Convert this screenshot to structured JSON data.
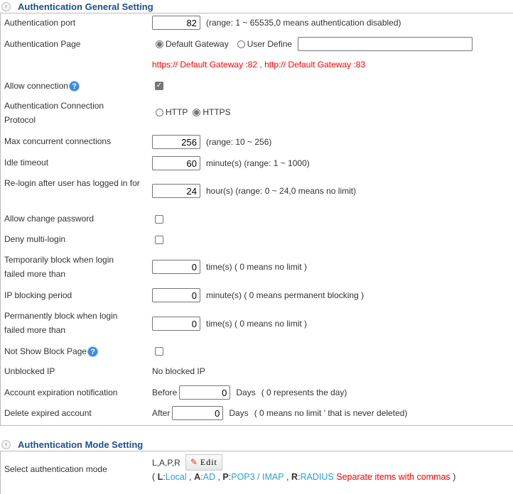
{
  "general": {
    "title": "Authentication General Setting",
    "auth_port": {
      "label": "Authentication port",
      "value": "82",
      "hint": "(range: 1 ~ 65535,0 means authentication disabled)"
    },
    "auth_page": {
      "label": "Authentication Page",
      "options": [
        "Default Gateway",
        "User Define"
      ],
      "selected": "Default Gateway",
      "user_define_value": "",
      "note": "https:// Default Gateway :82 ,  http:// Default Gateway :83"
    },
    "allow_connection": {
      "label": "Allow connection",
      "checked": true,
      "help_icon": "help-icon"
    },
    "protocol": {
      "label": "Authentication Connection Protocol",
      "options": [
        "HTTP",
        "HTTPS"
      ],
      "selected": "HTTPS"
    },
    "max_conn": {
      "label": "Max concurrent connections",
      "value": "256",
      "hint": "(range: 10 ~ 256)"
    },
    "idle_timeout": {
      "label": "Idle timeout",
      "value": "60",
      "hint": "minute(s) (range: 1 ~ 1000)"
    },
    "relogin": {
      "label": "Re-login after user has logged in for",
      "value": "24",
      "hint": "hour(s) (range: 0 ~ 24,0 means no limit)"
    },
    "allow_change_password": {
      "label": "Allow change password",
      "checked": false
    },
    "deny_multi_login": {
      "label": "Deny multi-login",
      "checked": false
    },
    "temp_block": {
      "label": "Temporarily block when login failed more than",
      "value": "0",
      "hint": "time(s) ( 0 means no limit )"
    },
    "ip_block_period": {
      "label": "IP blocking period",
      "value": "0",
      "hint": "minute(s) ( 0 means permanent blocking )"
    },
    "perm_block": {
      "label": "Permanently block when login failed more than",
      "value": "0",
      "hint": "time(s) ( 0 means no limit )"
    },
    "not_show_block": {
      "label": "Not Show Block Page",
      "checked": false
    },
    "unblocked_ip": {
      "label": "Unblocked IP",
      "value": "No blocked IP"
    },
    "expire_notify": {
      "label": "Account expiration notification",
      "prefix": "Before",
      "value": "0",
      "unit": "Days",
      "hint": "( 0 represents the day)"
    },
    "delete_expired": {
      "label": "Delete expired account",
      "prefix": "After",
      "value": "0",
      "unit": "Days",
      "hint": "( 0 means no limit ' that is never deleted)"
    }
  },
  "mode": {
    "title": "Authentication Mode Setting",
    "label": "Select authentication mode",
    "value": "L,A,P,R",
    "edit_label": "Edit",
    "legend": {
      "open": "(",
      "items": [
        {
          "key": "L",
          "sep": " : ",
          "name": "Local"
        },
        {
          "key": "A",
          "sep": " : ",
          "name": "AD"
        },
        {
          "key": "P",
          "sep": " : ",
          "name": "POP3 / IMAP"
        },
        {
          "key": "R",
          "sep": " : ",
          "name": "RADIUS"
        }
      ],
      "note": "Separate items with commas",
      "close": ")"
    }
  },
  "colors": {
    "title": "#1e4f8f",
    "note_red": "#ff0000",
    "link_blue": "#2a9fd6"
  }
}
